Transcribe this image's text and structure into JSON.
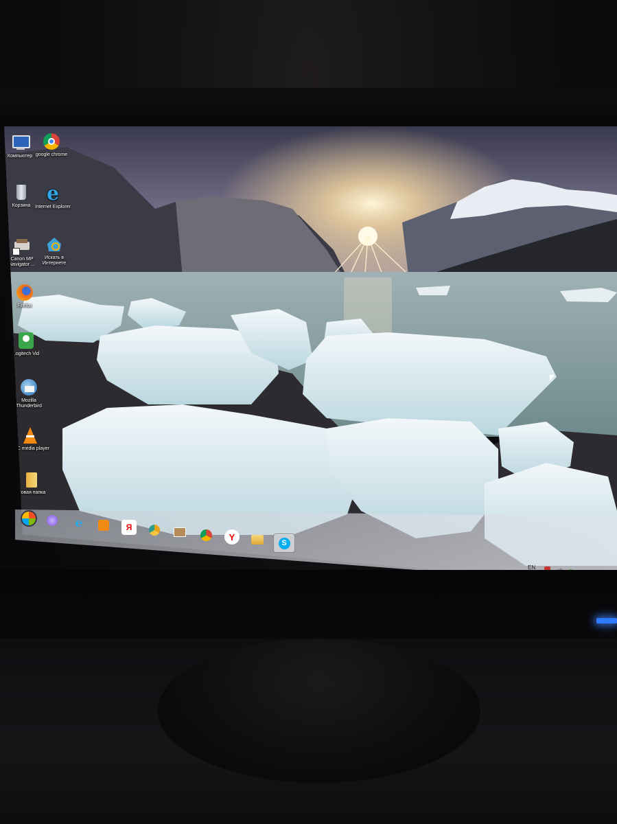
{
  "desktop_icons": [
    {
      "label": "Компьютер",
      "icon": "computer-icon"
    },
    {
      "label": "google chrome",
      "icon": "chrome-icon"
    },
    {
      "label": "Корзина",
      "icon": "recycle-bin-icon"
    },
    {
      "label": "Internet Explorer",
      "icon": "internet-explorer-icon"
    },
    {
      "label": "Canon MP Navigator ...",
      "icon": "canon-mp-navigator-icon"
    },
    {
      "label": "Искать в Интернете",
      "icon": "search-internet-icon"
    },
    {
      "label": "Firefox",
      "icon": "firefox-icon"
    },
    {
      "label": "Logitech Vid",
      "icon": "logitech-vid-icon"
    },
    {
      "label": "Mozilla Thunderbird",
      "icon": "thunderbird-icon"
    },
    {
      "label": "VLC media player",
      "icon": "vlc-icon"
    },
    {
      "label": "Новая папка",
      "icon": "folder-icon"
    }
  ],
  "taskbar": {
    "pinned": [
      "start-orb-icon",
      "alice-icon",
      "internet-explorer-icon",
      "media-player-icon",
      "yandex-icon",
      "chrome-canary-icon",
      "package-icon",
      "chrome-icon",
      "yandex-browser-icon",
      "folder-icon",
      "skype-icon"
    ],
    "yandex_glyph": "Я",
    "yandex_browser_glyph": "Y",
    "skype_glyph": "S"
  },
  "tray": {
    "language": "EN"
  },
  "colors": {
    "taskbar_glass": "#d8dbe2",
    "skype_blue": "#00aff0",
    "led_blue": "#2e7bff"
  }
}
